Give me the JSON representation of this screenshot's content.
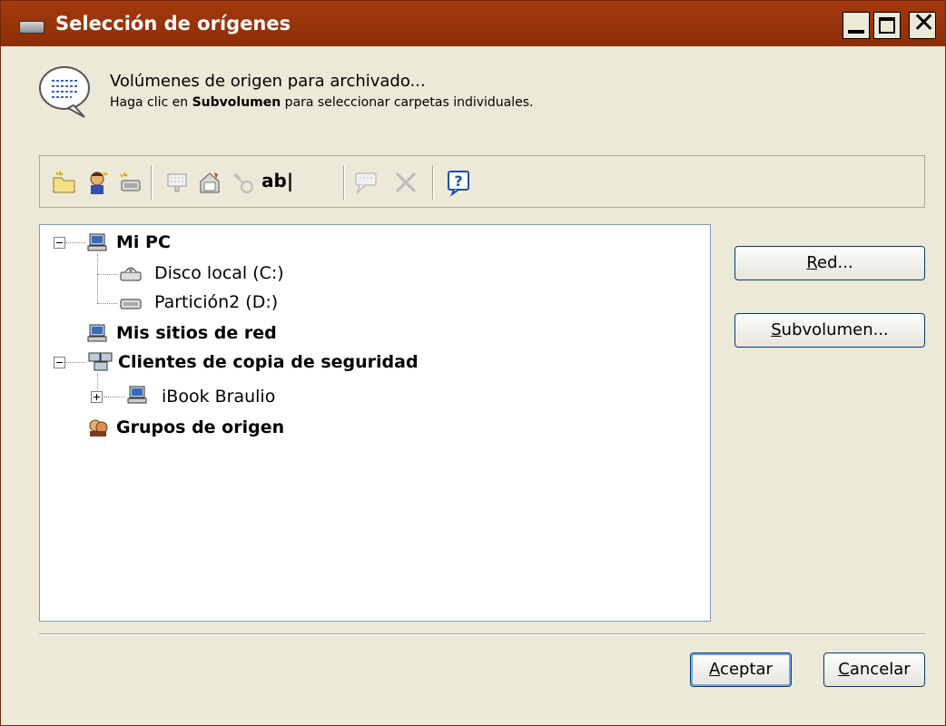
{
  "window": {
    "title": "Selección de orígenes"
  },
  "intro": {
    "line1": "Volúmenes de origen para archivado...",
    "line2_pre": "Haga clic en ",
    "line2_bold": "Subvolumen",
    "line2_post": " para seleccionar carpetas individuales."
  },
  "toolbar": {
    "tools": [
      "new-folder-icon",
      "new-client-icon",
      "new-group-icon",
      "exclude-icon",
      "properties-icon",
      "key-icon",
      "rename-icon",
      "comment-icon",
      "delete-icon",
      "help-icon"
    ],
    "rename_label": "ab|"
  },
  "tree": {
    "my_pc": "Mi PC",
    "disk_c": "Disco local (C:)",
    "disk_d": "Partición2 (D:)",
    "network_places": "Mis sitios de red",
    "backup_clients": "Clientes de copia de seguridad",
    "client_ibook": "iBook Braulio",
    "source_groups": "Grupos de origen"
  },
  "buttons": {
    "red_first": "R",
    "red_rest": "ed...",
    "sub_first": "S",
    "sub_rest": "ubvolumen...",
    "ok_first": "A",
    "ok_rest": "ceptar",
    "cancel_first": "C",
    "cancel_rest": "ancelar"
  }
}
